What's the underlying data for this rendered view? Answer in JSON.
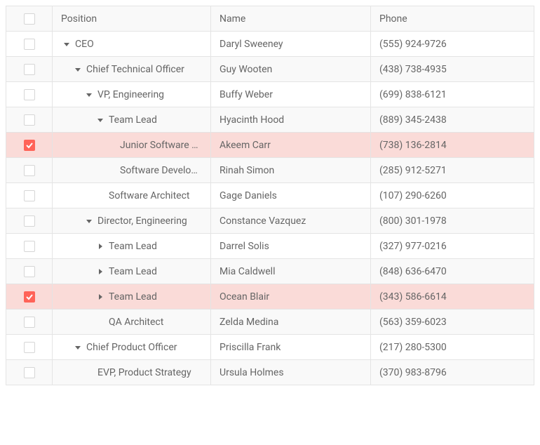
{
  "columns": {
    "position": "Position",
    "name": "Name",
    "phone": "Phone"
  },
  "rows": [
    {
      "position": "CEO",
      "name": "Daryl Sweeney",
      "phone": "(555) 924-9726",
      "depth": 0,
      "expander": "expanded",
      "selected": false,
      "alt": false
    },
    {
      "position": "Chief Technical Officer",
      "name": "Guy Wooten",
      "phone": "(438) 738-4935",
      "depth": 1,
      "expander": "expanded",
      "selected": false,
      "alt": true
    },
    {
      "position": "VP, Engineering",
      "name": "Buffy Weber",
      "phone": "(699) 838-6121",
      "depth": 2,
      "expander": "expanded",
      "selected": false,
      "alt": false
    },
    {
      "position": "Team Lead",
      "name": "Hyacinth Hood",
      "phone": "(889) 345-2438",
      "depth": 3,
      "expander": "expanded",
      "selected": false,
      "alt": true
    },
    {
      "position": "Junior Software …",
      "name": "Akeem Carr",
      "phone": "(738) 136-2814",
      "depth": 4,
      "expander": "none",
      "selected": true,
      "alt": false
    },
    {
      "position": "Software Develo…",
      "name": "Rinah Simon",
      "phone": "(285) 912-5271",
      "depth": 4,
      "expander": "none",
      "selected": false,
      "alt": true
    },
    {
      "position": "Software Architect",
      "name": "Gage Daniels",
      "phone": "(107) 290-6260",
      "depth": 3,
      "expander": "none",
      "selected": false,
      "alt": false
    },
    {
      "position": "Director, Engineering",
      "name": "Constance Vazquez",
      "phone": "(800) 301-1978",
      "depth": 2,
      "expander": "expanded",
      "selected": false,
      "alt": true
    },
    {
      "position": "Team Lead",
      "name": "Darrel Solis",
      "phone": "(327) 977-0216",
      "depth": 3,
      "expander": "collapsed",
      "selected": false,
      "alt": false
    },
    {
      "position": "Team Lead",
      "name": "Mia Caldwell",
      "phone": "(848) 636-6470",
      "depth": 3,
      "expander": "collapsed",
      "selected": false,
      "alt": true
    },
    {
      "position": "Team Lead",
      "name": "Ocean Blair",
      "phone": "(343) 586-6614",
      "depth": 3,
      "expander": "collapsed",
      "selected": true,
      "alt": false
    },
    {
      "position": "QA Architect",
      "name": "Zelda Medina",
      "phone": "(563) 359-6023",
      "depth": 3,
      "expander": "none",
      "selected": false,
      "alt": true
    },
    {
      "position": "Chief Product Officer",
      "name": "Priscilla Frank",
      "phone": "(217) 280-5300",
      "depth": 1,
      "expander": "expanded",
      "selected": false,
      "alt": false
    },
    {
      "position": "EVP, Product Strategy",
      "name": "Ursula Holmes",
      "phone": "(370) 983-8796",
      "depth": 2,
      "expander": "none",
      "selected": false,
      "alt": true
    }
  ]
}
